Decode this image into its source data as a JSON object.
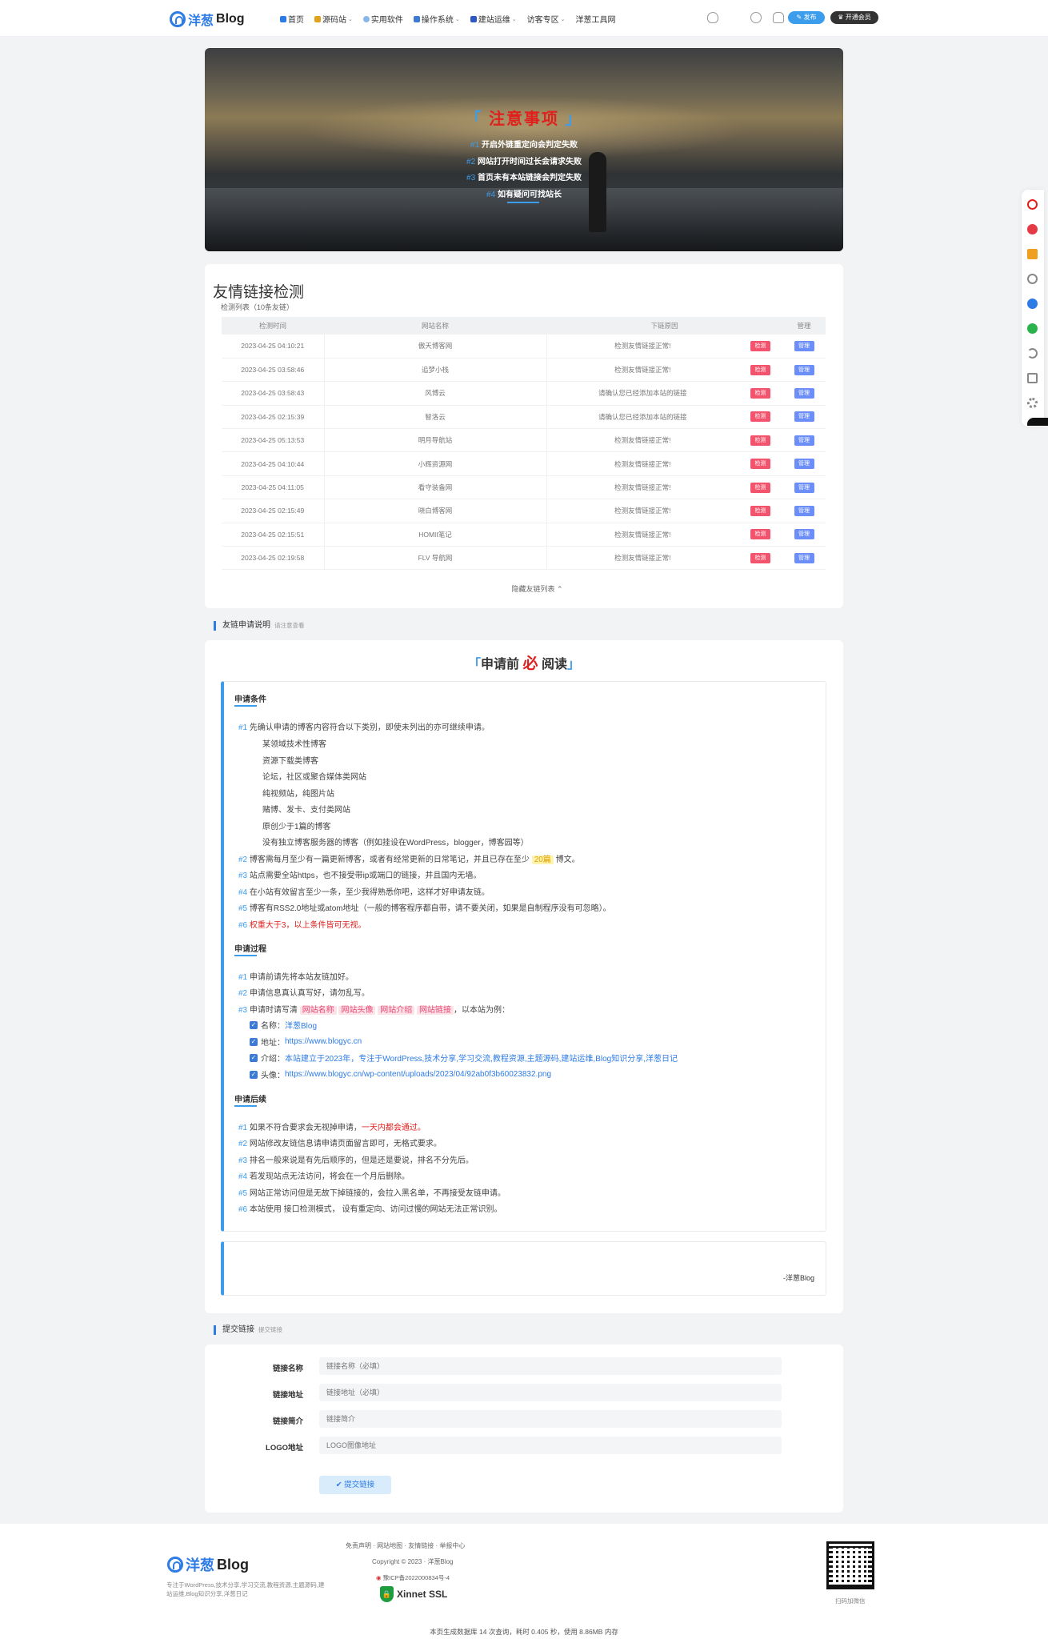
{
  "header": {
    "logo_text1": "洋葱",
    "logo_text2": "Blog",
    "nav": [
      {
        "label": "首页",
        "icon": "home-icon",
        "dropdown": false
      },
      {
        "label": "源码站",
        "icon": "code-icon",
        "dropdown": true
      },
      {
        "label": "实用软件",
        "icon": "cloud-icon",
        "dropdown": false
      },
      {
        "label": "操作系统",
        "icon": "windows-icon",
        "dropdown": true
      },
      {
        "label": "建站运维",
        "icon": "server-icon",
        "dropdown": true
      },
      {
        "label": "访客专区",
        "icon": "",
        "dropdown": true
      },
      {
        "label": "洋葱工具网",
        "icon": "",
        "dropdown": false
      }
    ],
    "publish_label": "发布",
    "vip_label": "开通会员"
  },
  "hero": {
    "title": "注意事项",
    "lines": [
      {
        "num": "#1",
        "text": "开启外链重定向会判定失败"
      },
      {
        "num": "#2",
        "text": "网站打开时间过长会请求失败"
      },
      {
        "num": "#3",
        "text": "首页未有本站链接会判定失败"
      },
      {
        "num": "#4",
        "text": "如有疑问可找站长"
      }
    ]
  },
  "check": {
    "title": "友情链接检测",
    "subtitle": "检测列表（10条友链）",
    "columns": [
      "检测时间",
      "网站名称",
      "下链原因",
      "管理"
    ],
    "rows": [
      {
        "time": "2023-04-25 04:10:21",
        "name": "傲天博客网",
        "reason": "检测友情链接正常!",
        "ok": true
      },
      {
        "time": "2023-04-25 03:58:46",
        "name": "追梦小栈",
        "reason": "检测友情链接正常!",
        "ok": true
      },
      {
        "time": "2023-04-25 03:58:43",
        "name": "风博云",
        "reason": "请确认您已经添加本站的链接",
        "ok": false
      },
      {
        "time": "2023-04-25 02:15:39",
        "name": "智洛云",
        "reason": "请确认您已经添加本站的链接",
        "ok": false
      },
      {
        "time": "2023-04-25 05:13:53",
        "name": "明月导航站",
        "reason": "检测友情链接正常!",
        "ok": true
      },
      {
        "time": "2023-04-25 04:10:44",
        "name": "小辉资源网",
        "reason": "检测友情链接正常!",
        "ok": true
      },
      {
        "time": "2023-04-25 04:11:05",
        "name": "看守装备网",
        "reason": "检测友情链接正常!",
        "ok": true
      },
      {
        "time": "2023-04-25 02:15:49",
        "name": "晓白博客网",
        "reason": "检测友情链接正常!",
        "ok": true
      },
      {
        "time": "2023-04-25 02:15:51",
        "name": "HOMII笔记",
        "reason": "检测友情链接正常!",
        "ok": true
      },
      {
        "time": "2023-04-25 02:19:58",
        "name": "FLV 导航网",
        "reason": "检测友情链接正常!",
        "ok": true
      }
    ],
    "tag_check": "检测",
    "tag_manage": "管理",
    "hide_label": "隐藏友链列表"
  },
  "apply_section": {
    "label": "友链申请说明",
    "sub": "请注意查看"
  },
  "read": {
    "title_pre": "申请前",
    "title_must": "必",
    "title_post": "阅读",
    "conditions_title": "申请条件",
    "cond1": "先确认申请的博客内容符合以下类别，即使未列出的亦可继续申请。",
    "categories": [
      "某领域技术性博客",
      "资源下载类博客",
      "论坛，社区或聚合媒体类网站",
      "纯视频站，纯图片站",
      "赌博、发卡、支付类网站",
      "原创少于1篇的博客",
      "没有独立博客服务器的博客（例如挂设在WordPress，blogger，博客园等）"
    ],
    "cond2_a": "博客需每月至少有一篇更新博客，或者有经常更新的日常笔记，并且已存在至少",
    "cond2_b": "20篇",
    "cond2_c": "博文。",
    "cond3": "站点需要全站https，也不接受带ip或端口的链接，并且国内无墙。",
    "cond4": "在小站有效留言至少一条，至少我得熟悉你吧，这样才好申请友链。",
    "cond5": "博客有RSS2.0地址或atom地址（一般的博客程序都自带，请不要关闭，如果是自制程序没有可忽略）。",
    "cond6": "权重大于3，以上条件皆可无视。",
    "process_title": "申请过程",
    "proc1": "申请前请先将本站友链加好。",
    "proc2": "申请信息真认真写好，请勿乱写。",
    "proc3": "申请时请写清",
    "proc3_tags": [
      "网站名称",
      "网站头像",
      "网站介绍",
      "网站链接"
    ],
    "proc3_end": "，以本站为例：",
    "example": [
      {
        "k": "名称：",
        "v": "洋葱Blog"
      },
      {
        "k": "地址：",
        "v": "https://www.blogyc.cn"
      },
      {
        "k": "介绍：",
        "v": "本站建立于2023年，专注于WordPress,技术分享,学习交流,教程资源,主题源码,建站运维,Blog知识分享,洋葱日记"
      },
      {
        "k": "头像：",
        "v": "https://www.blogyc.cn/wp-content/uploads/2023/04/92ab0f3b60023832.png"
      }
    ],
    "after_title": "申请后续",
    "after1_a": "如果不符合要求会无视掉申请，",
    "after1_b": "一天内都会通过。",
    "after2": "网站修改友链信息请申请页面留言即可，无格式要求。",
    "after3": "排名一般来说是有先后顺序的，但是还是要说，排名不分先后。",
    "after4": "若发现站点无法访问，将会在一个月后删除。",
    "after5": "网站正常访问但是无故下掉链接的，会拉入黑名单，不再接受友链申请。",
    "after6": "本站使用 接口检测模式， 设有重定向、访问过慢的网站无法正常识别。",
    "signature": "-洋葱Blog"
  },
  "submit_section": {
    "label": "提交链接",
    "sub": "提交链接"
  },
  "form": {
    "name_label": "链接名称",
    "name_ph": "链接名称（必填）",
    "url_label": "链接地址",
    "url_ph": "链接地址（必填）",
    "desc_label": "链接简介",
    "desc_ph": "链接简介",
    "logo_label": "LOGO地址",
    "logo_ph": "LOGO图像地址",
    "submit": "✔ 提交链接"
  },
  "footer": {
    "links": "免责声明 · 网站地图 · 友情链接 · 举报中心",
    "copyright": "Copyright © 2023 · 洋葱Blog",
    "icp": "豫ICP备2022000834号-4",
    "ssl": "Xinnet SSL",
    "desc": "专注于WordPress,技术分享,学习交流,教程资源,主题源码,建站运维,Blog知识分享,洋葱日记",
    "qr_label": "扫码加微信",
    "stats": "本页生成数据库 14 次查询，耗时 0.405 秒，使用 8.86MB 内存"
  }
}
